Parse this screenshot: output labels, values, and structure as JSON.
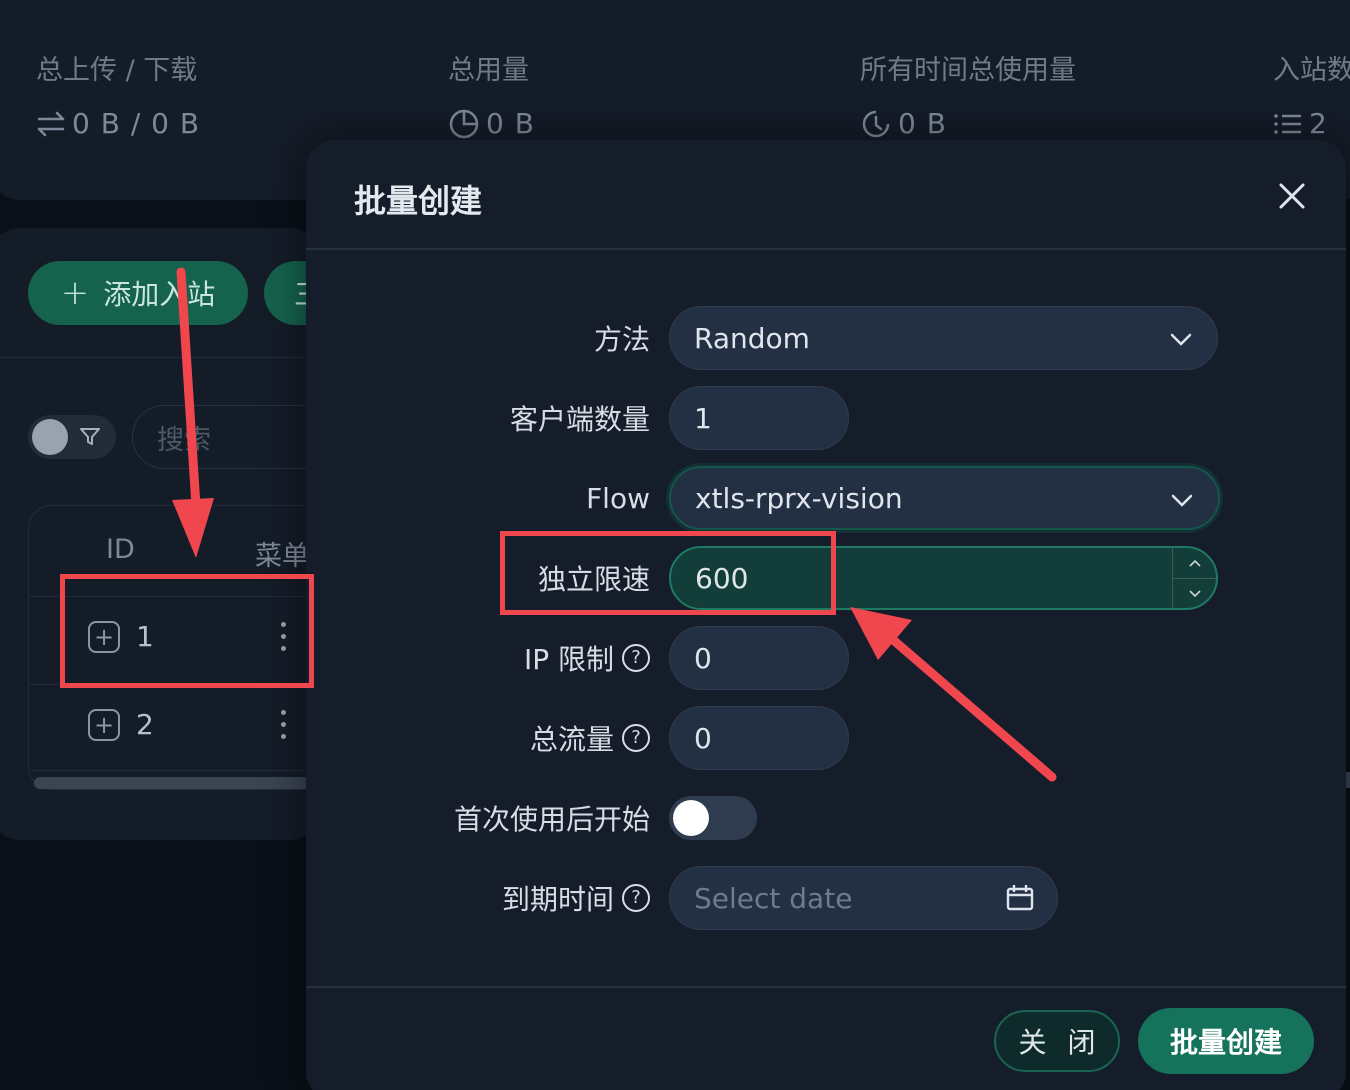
{
  "stats": [
    {
      "label": "总上传 / 下载",
      "value": "0 B / 0 B",
      "icon": "swap-arrows-icon"
    },
    {
      "label": "总用量",
      "value": "0 B",
      "icon": "pie-chart-icon"
    },
    {
      "label": "所有时间总使用量",
      "value": "0 B",
      "icon": "history-clock-icon"
    },
    {
      "label": "入站数",
      "value": "2",
      "icon": "list-icon"
    }
  ],
  "toolbar": {
    "add_inbound": "添加入站",
    "more": "三"
  },
  "search": {
    "placeholder": "搜索"
  },
  "table": {
    "headers": {
      "id": "ID",
      "menu": "菜单"
    },
    "rows": [
      {
        "id": "1"
      },
      {
        "id": "2"
      }
    ]
  },
  "modal": {
    "title": "批量创建",
    "fields": {
      "method": {
        "label": "方法",
        "value": "Random"
      },
      "client_count": {
        "label": "客户端数量",
        "value": "1"
      },
      "flow": {
        "label": "Flow",
        "value": "xtls-rprx-vision"
      },
      "speed_limit": {
        "label": "独立限速",
        "value": "600"
      },
      "ip_limit": {
        "label": "IP 限制",
        "value": "0"
      },
      "total_traffic": {
        "label": "总流量",
        "value": "0"
      },
      "start_after_first_use": {
        "label": "首次使用后开始",
        "checked": false
      },
      "expiry": {
        "label": "到期时间",
        "placeholder": "Select date"
      }
    },
    "buttons": {
      "close": "关 闭",
      "create": "批量创建"
    }
  },
  "colors": {
    "accent": "#15735b",
    "annotation": "#f0474f",
    "background": "#0a0f18",
    "modal": "#151d2a"
  }
}
